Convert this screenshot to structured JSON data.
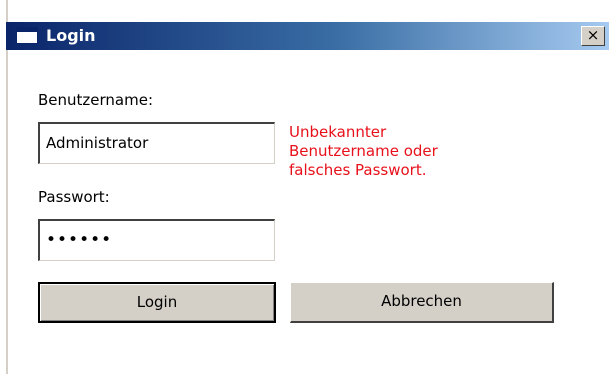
{
  "window": {
    "title": "Login",
    "close_symbol": "×"
  },
  "form": {
    "username_label": "Benutzername:",
    "username_value": "Administrator",
    "password_label": "Passwort:",
    "password_value": "••••••",
    "error_lines": [
      "Unbekannter",
      "Benutzername oder",
      "falsches Passwort."
    ]
  },
  "buttons": {
    "login_label": "Login",
    "cancel_label": "Abbrechen"
  },
  "icons": {
    "app": "window-app-icon",
    "close": "close-icon"
  },
  "colors": {
    "error": "#e8101a",
    "titlebar_start": "#0a246a",
    "titlebar_end": "#a6caf0",
    "button_face": "#d4d0c8"
  }
}
